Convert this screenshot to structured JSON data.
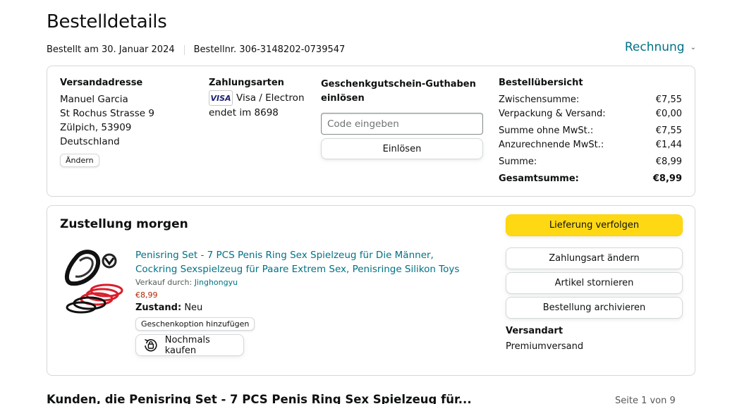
{
  "page": {
    "title": "Bestelldetails",
    "ordered_on": "Bestellt am 30. Januar 2024",
    "order_number": "Bestellnr. 306-3148202-0739547",
    "invoice_label": "Rechnung"
  },
  "shipping_address": {
    "heading": "Versandadresse",
    "lines": [
      "Manuel Garcia",
      "St Rochus Strasse 9",
      "Zülpich, 53909",
      "Deutschland"
    ],
    "change_label": "Ändern"
  },
  "payment": {
    "heading": "Zahlungsarten",
    "card_brand": "VISA",
    "card_type": "Visa / Electron",
    "card_ending": "endet im 8698"
  },
  "gift_card": {
    "heading": "Geschenkgutschein-Guthaben einlösen",
    "placeholder": "Code eingeben",
    "redeem_label": "Einlösen"
  },
  "summary": {
    "heading": "Bestellübersicht",
    "rows": [
      {
        "label": "Zwischensumme:",
        "value": "€7,55"
      },
      {
        "label": "Verpackung & Versand:",
        "value": "€0,00"
      },
      {
        "label": "Summe ohne MwSt.:",
        "value": "€7,55"
      },
      {
        "label": "Anzurechnende MwSt.:",
        "value": "€1,44"
      },
      {
        "label": "Summe:",
        "value": "€8,99"
      }
    ],
    "total_label": "Gesamtsumme:",
    "total_value": "€8,99"
  },
  "delivery": {
    "title": "Zustellung morgen",
    "product": {
      "title": "Penisring Set - 7 PCS Penis Ring Sex Spielzeug für Die Männer, Cockring Sexspielzeug für Paare Extrem Sex, Penisringe Silikon Toys",
      "seller_prefix": "Verkauf durch:",
      "seller_name": "Jinghongyu",
      "price": "€8,99",
      "condition_label": "Zustand:",
      "condition_value": "Neu",
      "gift_option_label": "Geschenkoption hinzufügen",
      "buy_again_label": "Nochmals kaufen"
    },
    "actions": {
      "track": "Lieferung verfolgen",
      "change_payment": "Zahlungsart ändern",
      "cancel": "Artikel stornieren",
      "archive": "Bestellung archivieren"
    },
    "shipping_method_label": "Versandart",
    "shipping_method_value": "Premiumversand"
  },
  "recommendations": {
    "title": "Kunden, die Penisring Set - 7 PCS Penis Ring Sex Spielzeug für...",
    "pager": "Seite 1 von 9"
  },
  "colors": {
    "link": "#007185",
    "primary_button": "#FFD814",
    "price": "#B12704",
    "border": "#D5D9D9"
  }
}
